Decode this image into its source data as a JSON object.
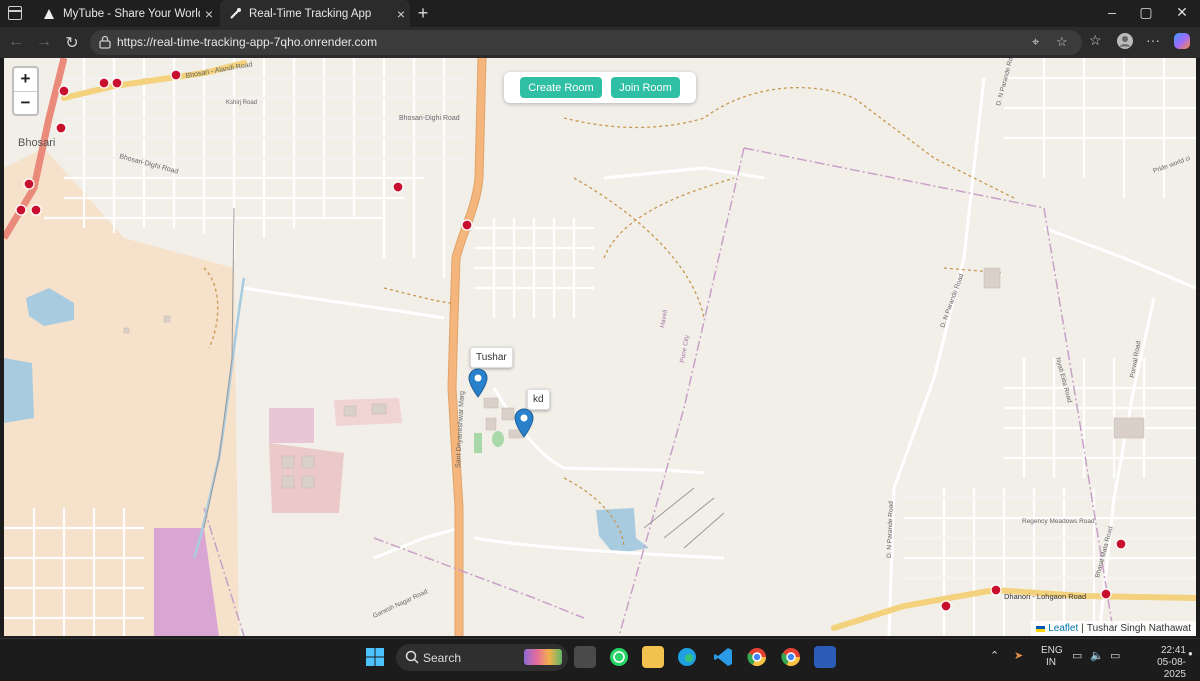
{
  "browser": {
    "tabs": [
      {
        "title": "MyTube - Share Your World",
        "close": "×"
      },
      {
        "title": "Real-Time Tracking App",
        "close": "×"
      }
    ],
    "new_tab": "+",
    "url": "https://real-time-tracking-app-7qho.onrender.com"
  },
  "map": {
    "zoom_in": "+",
    "zoom_out": "−",
    "buttons": {
      "create": "Create Room",
      "join": "Join Room"
    },
    "markers": [
      {
        "label": "Tushar"
      },
      {
        "label": "kd"
      }
    ],
    "place_labels": {
      "bhosari": "Bhosari",
      "bhosari_alandi": "Bhosari - Alandi Road",
      "kshirj_road": "Kshirj Road",
      "bhosari_dighi_1": "Bhosari-Dighi Road",
      "bhosari_dighi_2": "Bhosari-Dighi Road",
      "sant_dnyaneshwar": "Sant Dnyaneshwar Marg",
      "dn_parande_1": "D. N Parande Road",
      "dn_parande_2": "D. N Parande Road",
      "dn_parande_3": "D. N Parande Road",
      "haveli": "Haveli",
      "pune_city": "Pune City",
      "nyati_eiita": "Nyati Eiita Road",
      "regency_meadows": "Regency Meadows Road",
      "bharat_mata": "Bharat Mata Road",
      "dhanori_lohgaon": "Dhanori - Lohgaon Road",
      "ganesh_nagar": "Ganesh Nagar Road",
      "pride_world": "Pride world ci",
      "porwal_road": "Porwal Road"
    },
    "attribution": {
      "leaflet": "Leaflet",
      "separator": "|",
      "author": "Tushar Singh Nathawat"
    }
  },
  "taskbar": {
    "search": "Search",
    "lang": [
      "ENG",
      "IN"
    ],
    "time": "22:41",
    "date": "05-08-2025"
  },
  "colors": {
    "accent_button": "#2ebfa5",
    "marker": "#2a81cb",
    "main_road": "#f4b67d",
    "map_bg": "#f2efe9"
  }
}
